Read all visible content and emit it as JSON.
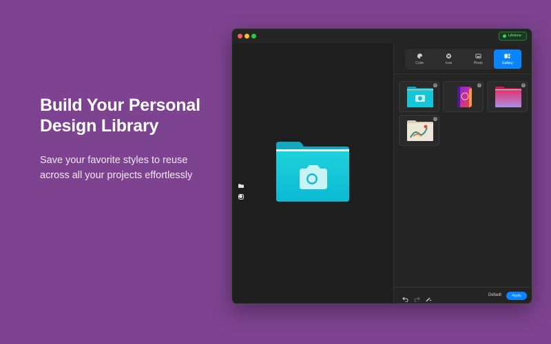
{
  "marketing": {
    "headline_line1": "Build Your Personal",
    "headline_line2": "Design Library",
    "subtext_line1": "Save your favorite styles to reuse",
    "subtext_line2": "across all your projects effortlessly"
  },
  "window": {
    "badge": "Lifetime",
    "badge_color": "#3bd35a"
  },
  "tabs": [
    {
      "label": "Color",
      "icon": "palette-icon"
    },
    {
      "label": "Icon",
      "icon": "icon-icon"
    },
    {
      "label": "Photo",
      "icon": "photo-icon"
    },
    {
      "label": "Gallery",
      "icon": "gallery-icon",
      "active": true
    }
  ],
  "gallery": {
    "items": [
      {
        "name": "cyan-camera-folder"
      },
      {
        "name": "purple-book-folder"
      },
      {
        "name": "pink-gradient-folder"
      },
      {
        "name": "illustration-folder"
      }
    ]
  },
  "footer": {
    "default_label": "Default",
    "apply_label": "Apply"
  },
  "colors": {
    "background": "#7d4390",
    "accent": "#0a84ff",
    "folder": "#1ec8d8"
  }
}
